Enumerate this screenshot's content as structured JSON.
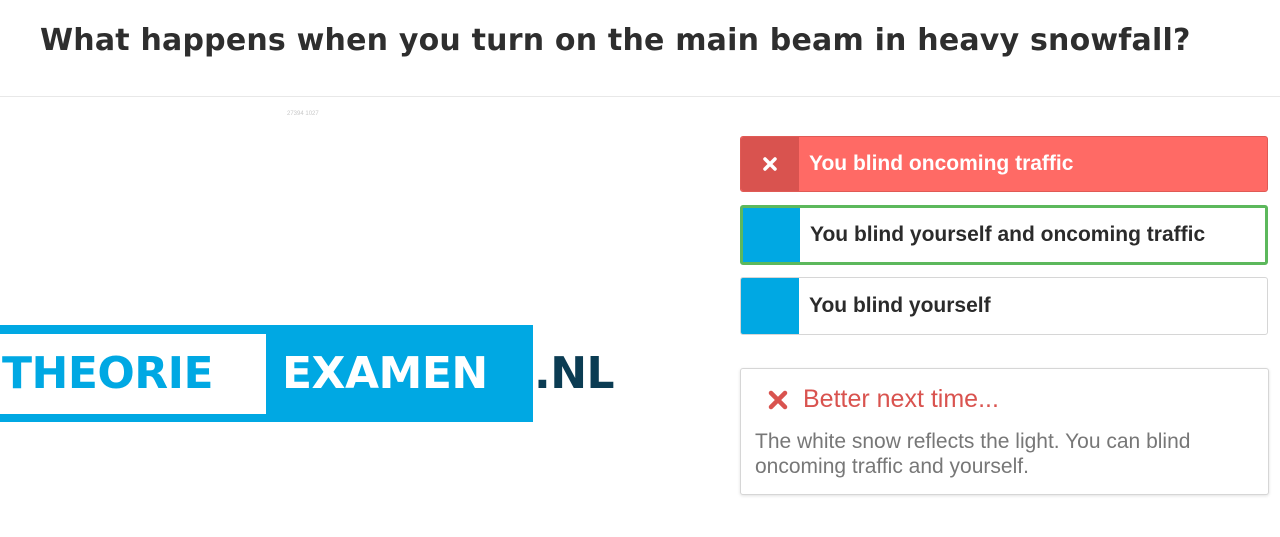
{
  "question": {
    "text": "What happens when you turn on the main beam in heavy snowfall?"
  },
  "image": {
    "stamp": "27394 1027",
    "logo": {
      "part1": "THEORIE",
      "part2": "EXAMEN",
      "part3": ".NL"
    }
  },
  "answers": [
    {
      "label": "You blind oncoming traffic",
      "state": "selected-wrong",
      "icon": "close-icon"
    },
    {
      "label": "You blind yourself and oncoming traffic",
      "state": "correct"
    },
    {
      "label": "You blind yourself",
      "state": "neutral"
    }
  ],
  "feedback": {
    "icon": "close-icon",
    "title": "Better next time...",
    "body": "The white snow reflects the light. You can blind oncoming traffic and yourself."
  },
  "colors": {
    "accent": "#00a8e3",
    "wrong": "#ff6a65",
    "wrong_dark": "#d9534f",
    "correct_border": "#5cb85c",
    "logo_dark": "#0b3c53"
  }
}
